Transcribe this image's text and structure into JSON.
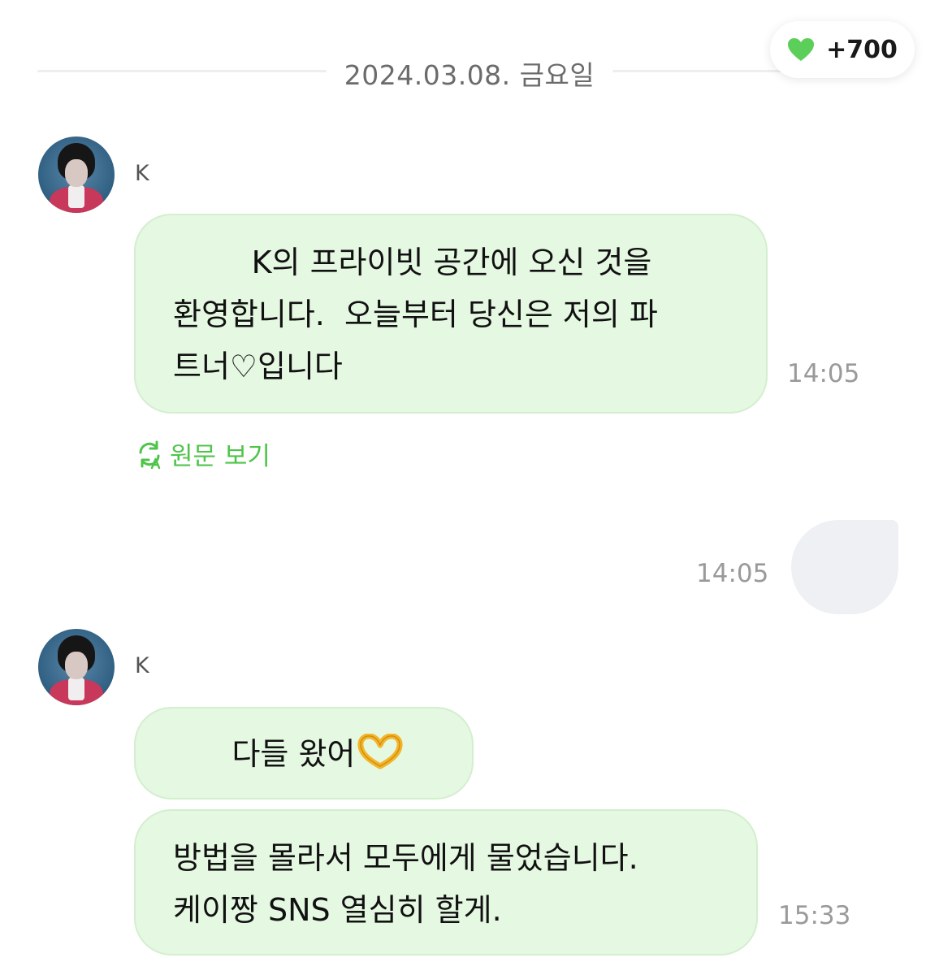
{
  "header": {
    "date": "2024.03.08. 금요일",
    "points": "+700",
    "points_icon": "green-heart-icon",
    "heart_color": "#5ccf5a"
  },
  "messages": [
    {
      "sender": "K",
      "lines": [
        "        K의 프라이빗 공간에 오신 것을",
        "환영합니다.  오늘부터 당신은 저의 파",
        "트너♡입니다"
      ],
      "time": "14:05",
      "translate_label": "원문 보기"
    },
    {
      "outgoing": true,
      "time": "14:05"
    },
    {
      "sender": "K",
      "bubbles": [
        {
          "lines": [
            "      다들 왔어"
          ],
          "emoji": "heart-hands-emoji"
        },
        {
          "lines": [
            "방법을 몰라서 모두에게 물었습니다.",
            "케이짱 SNS 열심히 할게."
          ]
        }
      ],
      "time": "15:33"
    }
  ],
  "colors": {
    "bubble_bg": "#e5f8e2",
    "accent_green": "#4fc44a",
    "time_gray": "#9a9a9a"
  }
}
